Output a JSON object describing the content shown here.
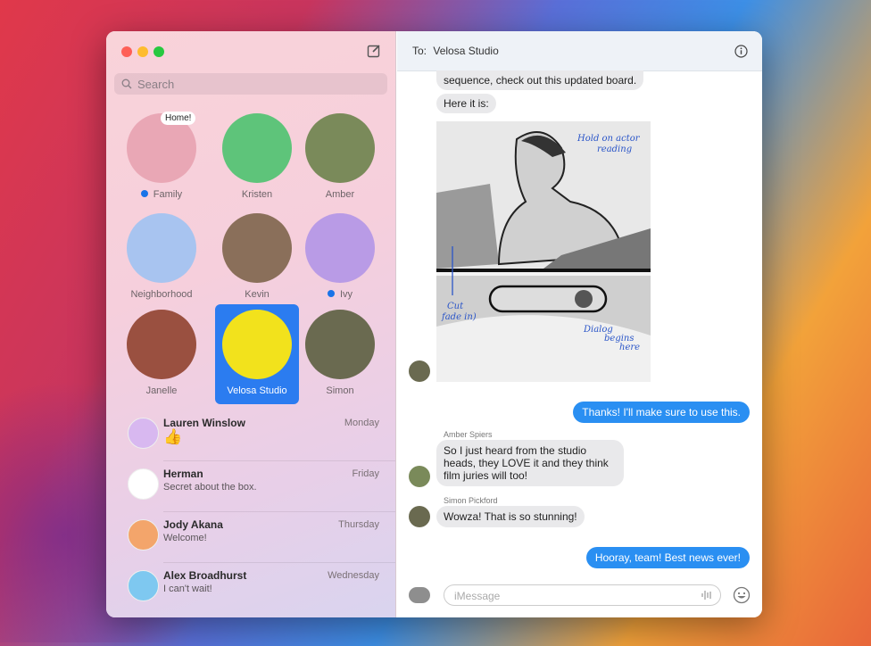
{
  "sidebar": {
    "search_placeholder": "Search",
    "pinned": [
      {
        "label": "Family",
        "unread": true,
        "badge": "Home!",
        "color": "#e9a7b5"
      },
      {
        "label": "Kristen",
        "unread": false,
        "color": "#5ec47a"
      },
      {
        "label": "Amber",
        "unread": false,
        "color": "#7a8a5a"
      },
      {
        "label": "Neighborhood",
        "unread": false,
        "color": "#a8c4f0"
      },
      {
        "label": "Kevin",
        "unread": false,
        "color": "#8a6f5a"
      },
      {
        "label": "Ivy",
        "unread": true,
        "color": "#b99be6"
      },
      {
        "label": "Janelle",
        "unread": false,
        "color": "#9a5040"
      },
      {
        "label": "Velosa Studio",
        "unread": false,
        "selected": true,
        "color": "#f2e21c"
      },
      {
        "label": "Simon",
        "unread": false,
        "color": "#6a6a50"
      }
    ],
    "conversations": [
      {
        "name": "Lauren Winslow",
        "date": "Monday",
        "preview": "👍",
        "color": "#d8b8f0"
      },
      {
        "name": "Herman",
        "date": "Friday",
        "preview": "Secret about the box.",
        "color": "#ffffff"
      },
      {
        "name": "Jody Akana",
        "date": "Thursday",
        "preview": "Welcome!",
        "color": "#f3a56b"
      },
      {
        "name": "Alex Broadhurst",
        "date": "Wednesday",
        "preview": "I can't wait!",
        "color": "#7ec8f0"
      }
    ]
  },
  "chat": {
    "to_label": "To:",
    "recipient": "Velosa Studio",
    "messages": [
      {
        "text": "sequence, check out this updated board."
      },
      {
        "text": "Here it is:"
      },
      {
        "sketch_notes": [
          "Hold on actor",
          "reading",
          "Cut",
          "fade in)",
          "Dialog",
          "begins",
          "here"
        ]
      },
      {
        "text": "Thanks! I'll make sure to use this."
      },
      {
        "sender": "Amber Spiers",
        "text": "So I just heard from the studio heads, they LOVE it and they think film juries will too!"
      },
      {
        "sender": "Simon Pickford",
        "text": "Wowza! That is so stunning!"
      },
      {
        "text": "Hooray, team! Best news ever!"
      }
    ],
    "input_placeholder": "iMessage"
  },
  "colors": {
    "accent": "#2a8ff2",
    "selected": "#2b7cf0"
  }
}
